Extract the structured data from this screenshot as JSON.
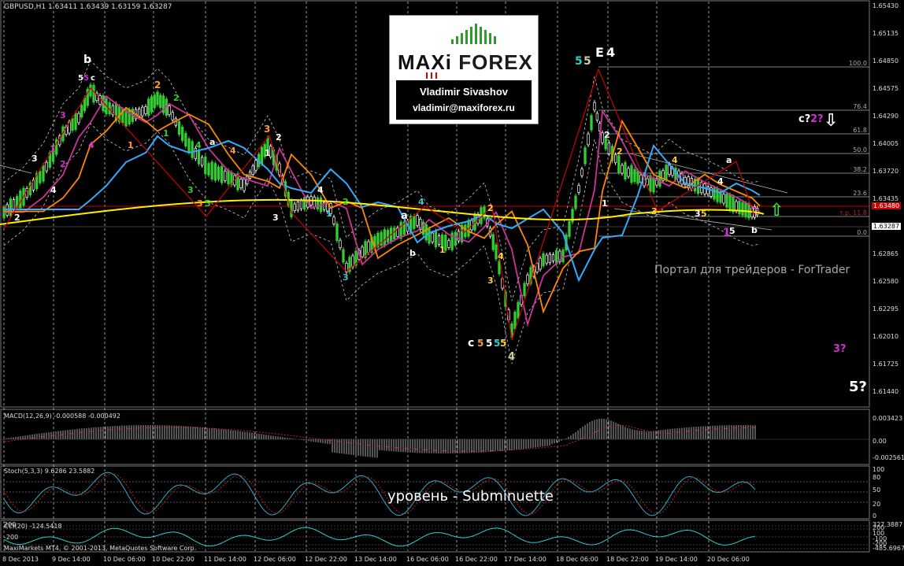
{
  "window": {
    "symbol_header": "GBPUSD,H1  1.63411 1.63439 1.63159 1.63287"
  },
  "logo": {
    "brand_left": "MAXi",
    "brand_right": "FOREX",
    "author": "Vladimir Sivashov",
    "email": "vladimir@maxiforex.ru"
  },
  "watermark": "Портал для трейдеров - ForTrader",
  "level_text": "уровень - Subminuette",
  "footer": "MaxiMarkets MT4, © 2001-2013, MetaQuotes Software Corp.",
  "price_axis": [
    "1.65430",
    "1.65135",
    "1.64850",
    "1.64575",
    "1.64290",
    "1.64005",
    "1.63720",
    "1.63435",
    "1.63150",
    "1.62865",
    "1.62580",
    "1.62295",
    "1.62010",
    "1.61725",
    "1.61440"
  ],
  "price_badges": {
    "bid": "1.63480",
    "last": "1.63287"
  },
  "time_axis": [
    "8 Dec 2013",
    "9 Dec 14:00",
    "10 Dec 06:00",
    "10 Dec 22:00",
    "11 Dec 14:00",
    "12 Dec 06:00",
    "12 Dec 22:00",
    "13 Dec 14:00",
    "16 Dec 06:00",
    "16 Dec 22:00",
    "17 Dec 14:00",
    "18 Dec 06:00",
    "18 Dec 22:00",
    "19 Dec 14:00",
    "20 Dec 06:00"
  ],
  "fibo": [
    {
      "label": "100.0"
    },
    {
      "label": "76.4"
    },
    {
      "label": "61.8"
    },
    {
      "label": "50.0"
    },
    {
      "label": "38.2"
    },
    {
      "label": "23.6"
    },
    {
      "label": "т.р. 11.8"
    },
    {
      "label": "0.0"
    }
  ],
  "macd": {
    "title": "MACD(12,26,9) -0.000588 -0.000492",
    "axis": [
      "0.003423",
      "0.00",
      "-0.002561"
    ]
  },
  "stoch": {
    "title": "Stoch(5,3,3) 9.6286 23.5882",
    "axis": [
      "100",
      "80",
      "50",
      "20",
      "0"
    ]
  },
  "cci": {
    "title": "CCI(20) -124.5418",
    "axis_left": [
      "200",
      "-200"
    ],
    "axis_right": [
      "327.3887",
      "200",
      "100",
      "-100",
      "-200",
      "-485.6967"
    ]
  },
  "wave_labels": [
    {
      "text": "b",
      "color": "#ffffff"
    },
    {
      "text": "5",
      "color": "#ffffff"
    },
    {
      "text": "5",
      "color": "#cc33cc"
    },
    {
      "text": "c",
      "color": "#ffffff"
    },
    {
      "text": "2",
      "color": "#ff9933"
    },
    {
      "text": "2",
      "color": "#33cc33"
    },
    {
      "text": "3",
      "color": "#cc33cc"
    },
    {
      "text": "1",
      "color": "#cc33cc"
    },
    {
      "text": "4",
      "color": "#cc33cc"
    },
    {
      "text": "3",
      "color": "#ffffff"
    },
    {
      "text": "4",
      "color": "#ffffff"
    },
    {
      "text": "2",
      "color": "#cc33cc"
    },
    {
      "text": "2",
      "color": "#ffffff"
    },
    {
      "text": "1",
      "color": "#ff9933"
    },
    {
      "text": "3",
      "color": "#ff9933"
    },
    {
      "text": "1",
      "color": "#33cc33"
    },
    {
      "text": "4",
      "color": "#33cc33"
    },
    {
      "text": "a",
      "color": "#ffffff"
    },
    {
      "text": "3",
      "color": "#33cc33"
    },
    {
      "text": "3",
      "color": "#ff9933"
    },
    {
      "text": "5",
      "color": "#33cc33"
    },
    {
      "text": "4",
      "color": "#ff9933"
    },
    {
      "text": "2",
      "color": "#ffffff"
    },
    {
      "text": "1",
      "color": "#ffffff"
    },
    {
      "text": "4",
      "color": "#ffffff"
    },
    {
      "text": "2",
      "color": "#33cc33"
    },
    {
      "text": "3",
      "color": "#ffffff"
    },
    {
      "text": "1",
      "color": "#33cccc"
    },
    {
      "text": "3",
      "color": "#33cccc"
    },
    {
      "text": "a",
      "color": "#ffffff"
    },
    {
      "text": "4",
      "color": "#33cccc"
    },
    {
      "text": "b",
      "color": "#ffffff"
    },
    {
      "text": "1",
      "color": "#ffcc33"
    },
    {
      "text": "2",
      "color": "#ffcc33"
    },
    {
      "text": "4",
      "color": "#ffcc33"
    },
    {
      "text": "3",
      "color": "#ffcc33"
    },
    {
      "text": "c",
      "color": "#ffffff"
    },
    {
      "text": "5",
      "color": "#ff9933"
    },
    {
      "text": "5",
      "color": "#ffffff"
    },
    {
      "text": "5",
      "color": "#33cccc"
    },
    {
      "text": "5",
      "color": "#ffcc33"
    },
    {
      "text": "4",
      "color": "#cccc99"
    },
    {
      "text": "5",
      "color": "#33cccc"
    },
    {
      "text": "5",
      "color": "#cccc99"
    },
    {
      "text": "E",
      "color": "#ffffff"
    },
    {
      "text": "4",
      "color": "#ffffff"
    },
    {
      "text": "2",
      "color": "#ffffff"
    },
    {
      "text": "2",
      "color": "#ffcc33"
    },
    {
      "text": "1",
      "color": "#ffffff"
    },
    {
      "text": "4",
      "color": "#ffcc33"
    },
    {
      "text": "a",
      "color": "#ffffff"
    },
    {
      "text": "4",
      "color": "#ffffff"
    },
    {
      "text": "3",
      "color": "#ffcc33"
    },
    {
      "text": "3",
      "color": "#ffffff"
    },
    {
      "text": "5",
      "color": "#ffcc33"
    },
    {
      "text": "1",
      "color": "#cc33cc"
    },
    {
      "text": "5",
      "color": "#ffffff"
    },
    {
      "text": "b",
      "color": "#ffffff"
    },
    {
      "text": "c?",
      "color": "#ffffff"
    },
    {
      "text": "2?",
      "color": "#cc33cc"
    },
    {
      "text": "3?",
      "color": "#cc33cc"
    },
    {
      "text": "5?",
      "color": "#ffffff"
    }
  ],
  "colors": {
    "background": "#000000",
    "candle_up": "#33cc33",
    "candle_down": "#ffffff",
    "ma_fast": "#cc3399",
    "ma_mid": "#ff8800",
    "ma_slow": "#33aaff",
    "ma_long": "#ffee00",
    "zigzag": "#cc0000",
    "bid_line": "#cc0000",
    "badge_bid": "#cc0000"
  },
  "icons": [
    "arrow-down-icon",
    "arrow-up-icon",
    "logo-bars-icon"
  ]
}
